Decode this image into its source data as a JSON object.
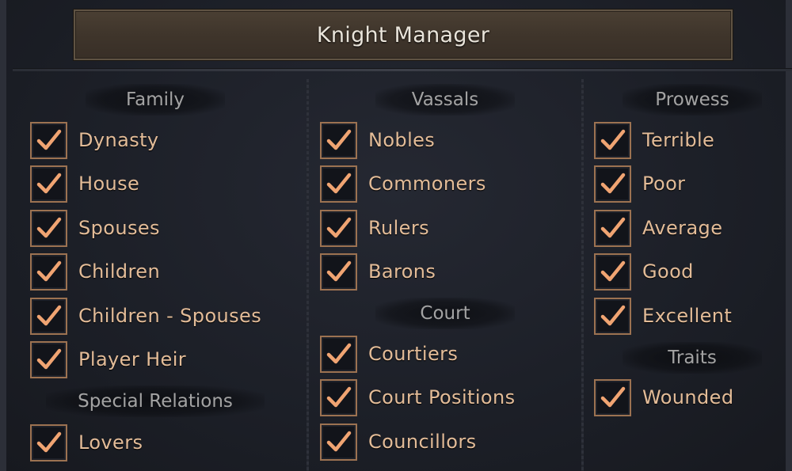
{
  "window": {
    "title": "Knight Manager"
  },
  "columns": [
    {
      "sections": [
        {
          "header": "Family",
          "options": [
            {
              "label": "Dynasty",
              "checked": true
            },
            {
              "label": "House",
              "checked": true
            },
            {
              "label": "Spouses",
              "checked": true
            },
            {
              "label": "Children",
              "checked": true
            },
            {
              "label": "Children - Spouses",
              "checked": true
            },
            {
              "label": "Player Heir",
              "checked": true
            }
          ]
        },
        {
          "header": "Special Relations",
          "options": [
            {
              "label": "Lovers",
              "checked": true
            }
          ]
        }
      ]
    },
    {
      "sections": [
        {
          "header": "Vassals",
          "options": [
            {
              "label": "Nobles",
              "checked": true
            },
            {
              "label": "Commoners",
              "checked": true
            },
            {
              "label": "Rulers",
              "checked": true
            },
            {
              "label": "Barons",
              "checked": true
            }
          ]
        },
        {
          "header": "Court",
          "options": [
            {
              "label": "Courtiers",
              "checked": true
            },
            {
              "label": "Court Positions",
              "checked": true
            },
            {
              "label": "Councillors",
              "checked": true
            }
          ]
        }
      ]
    },
    {
      "sections": [
        {
          "header": "Prowess",
          "options": [
            {
              "label": "Terrible",
              "checked": true
            },
            {
              "label": "Poor",
              "checked": true
            },
            {
              "label": "Average",
              "checked": true
            },
            {
              "label": "Good",
              "checked": true
            },
            {
              "label": "Excellent",
              "checked": true
            }
          ]
        },
        {
          "header": "Traits",
          "options": [
            {
              "label": "Wounded",
              "checked": true
            }
          ]
        }
      ]
    }
  ],
  "colors": {
    "accent": "#e3bc98",
    "checkbox_border": "#9c7251",
    "header_text": "#a3a3a3"
  },
  "icons": {
    "check": "checkmark-icon"
  }
}
